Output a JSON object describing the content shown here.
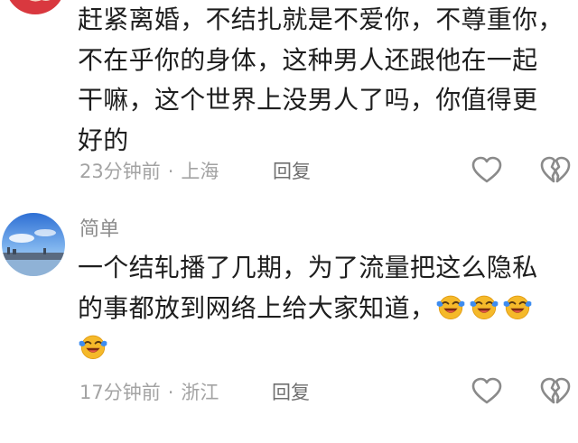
{
  "comments": [
    {
      "username": "",
      "lines": [
        "赶紧离婚，不结扎就是不爱你，不尊重你，",
        "不在乎你的身体，这种男人还跟他在一起",
        "干嘛，这个世界上没男人了吗，你值得更",
        "好的"
      ],
      "time": "23分钟前",
      "separator": "·",
      "location": "上海",
      "reply_label": "回复",
      "like_icon": "heart-outline-icon",
      "dislike_icon": "broken-heart-icon"
    },
    {
      "username": "简单",
      "lines": [
        "一个结轧播了几期，为了流量把这么隐私",
        "的事都放到网络上给大家知道，"
      ],
      "emoji": "laughing-crying-emoji",
      "emoji_count": 4,
      "time": "17分钟前",
      "separator": "·",
      "location": "浙江",
      "reply_label": "回复",
      "like_icon": "heart-outline-icon",
      "dislike_icon": "broken-heart-icon"
    }
  ],
  "colors": {
    "text": "#1e1e1e",
    "meta": "#a3a3a3",
    "reply": "#6f6f6f",
    "icon": "#8a8a8a",
    "emoji_face": "#f5b92a",
    "emoji_tear": "#3d8cf0"
  }
}
